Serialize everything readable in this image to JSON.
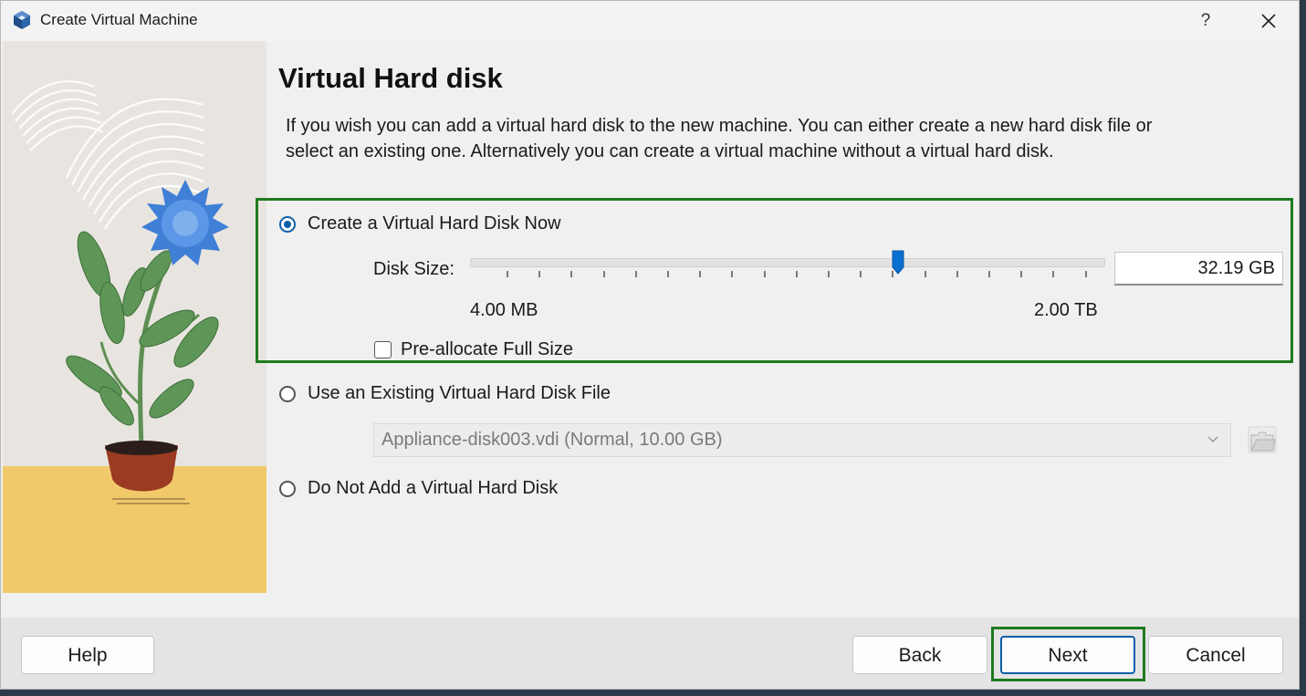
{
  "window": {
    "title": "Create Virtual Machine",
    "help_symbol": "?"
  },
  "page": {
    "title": "Virtual Hard disk",
    "description": "If you wish you can add a virtual hard disk to the new machine. You can either create a new hard disk file or select an existing one. Alternatively you can create a virtual machine without a virtual hard disk."
  },
  "options": {
    "create_now": {
      "label": "Create a Virtual Hard Disk Now",
      "selected": true
    },
    "use_existing": {
      "label": "Use an Existing Virtual Hard Disk File",
      "selected": false
    },
    "do_not_add": {
      "label": "Do Not Add a Virtual Hard Disk",
      "selected": false
    }
  },
  "disk_size": {
    "label": "Disk Size:",
    "value": "32.19 GB",
    "min_label": "4.00 MB",
    "max_label": "2.00 TB",
    "slider_fraction": 0.676
  },
  "preallocate": {
    "label": "Pre-allocate Full Size",
    "checked": false
  },
  "existing_disk": {
    "selected": "Appliance-disk003.vdi (Normal, 10.00 GB)"
  },
  "buttons": {
    "help": "Help",
    "back": "Back",
    "next": "Next",
    "cancel": "Cancel"
  },
  "colors": {
    "accent": "#0b5ea8",
    "highlight": "#1e7a1e"
  },
  "icons": {
    "app": "virtualbox-cube-icon",
    "close": "close-icon",
    "chevron": "chevron-down-icon",
    "folder": "folder-icon",
    "slider_handle": "slider-handle-icon"
  }
}
